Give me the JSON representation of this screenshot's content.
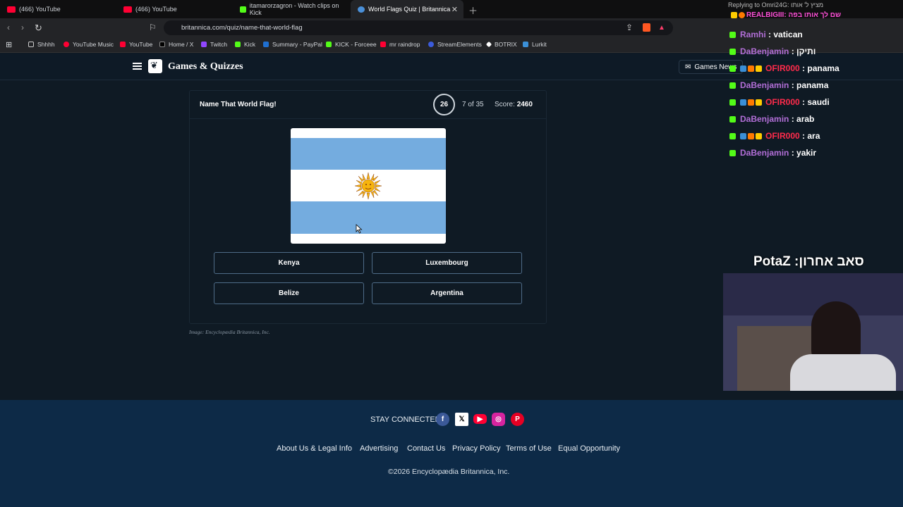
{
  "browser": {
    "tabs": [
      {
        "label": "(466) YouTube",
        "color": "#ff0033"
      },
      {
        "label": "(466) YouTube",
        "color": "#ff0033"
      },
      {
        "label": "itamarorzagron - Watch clips on Kick",
        "color": "#53fc18"
      },
      {
        "label": "World Flags Quiz | Britannica",
        "color": "#4a90d9"
      }
    ],
    "url": "britannica.com/quiz/name-that-world-flag",
    "bookmarks": [
      "Shhhh",
      "YouTube Music",
      "YouTube",
      "Home / X",
      "Twitch",
      "Kick",
      "Summary - PayPal",
      "KICK - Forceee",
      "mr raindrop",
      "StreamElements",
      "BOTRIX",
      "Lurkit"
    ]
  },
  "site": {
    "brand": "Games & Quizzes",
    "games_news": "Games News"
  },
  "quiz": {
    "title": "Name That World Flag!",
    "timer": "26",
    "progress": "7 of 35",
    "score_label": "Score:",
    "score_value": "2460",
    "answers": [
      "Kenya",
      "Luxembourg",
      "Belize",
      "Argentina"
    ],
    "image_credit": "Image: Encyclopædia Britannica, Inc."
  },
  "chat": {
    "replying": "Replying to Omri24G: מציץ ל' אותו",
    "top_line": "REALBIGIII: שם לך אותו בפה",
    "messages": [
      {
        "user": "Ramhi",
        "text": ": vatican",
        "color": "#b16ed6"
      },
      {
        "user": "DaBenjamin",
        "text": ": ותיקן",
        "color": "#b16ed6"
      },
      {
        "user": "OFIR000",
        "text": ": panama",
        "color": "#ff2b4b"
      },
      {
        "user": "DaBenjamin",
        "text": ": panama",
        "color": "#b16ed6"
      },
      {
        "user": "OFIR000",
        "text": ": saudi",
        "color": "#ff2b4b"
      },
      {
        "user": "DaBenjamin",
        "text": ": arab",
        "color": "#b16ed6"
      },
      {
        "user": "OFIR000",
        "text": ": ara",
        "color": "#ff2b4b"
      },
      {
        "user": "DaBenjamin",
        "text": ": yakir",
        "color": "#b16ed6"
      }
    ],
    "overlay_title": "סאב אחרון: PotaZ"
  },
  "footer": {
    "stay_connected": "STAY CONNECTED",
    "links": [
      "About Us & Legal Info",
      "Advertising",
      "Contact Us",
      "Privacy Policy",
      "Terms of Use",
      "Equal Opportunity"
    ],
    "copyright": "©2026 Encyclopædia Britannica, Inc."
  }
}
